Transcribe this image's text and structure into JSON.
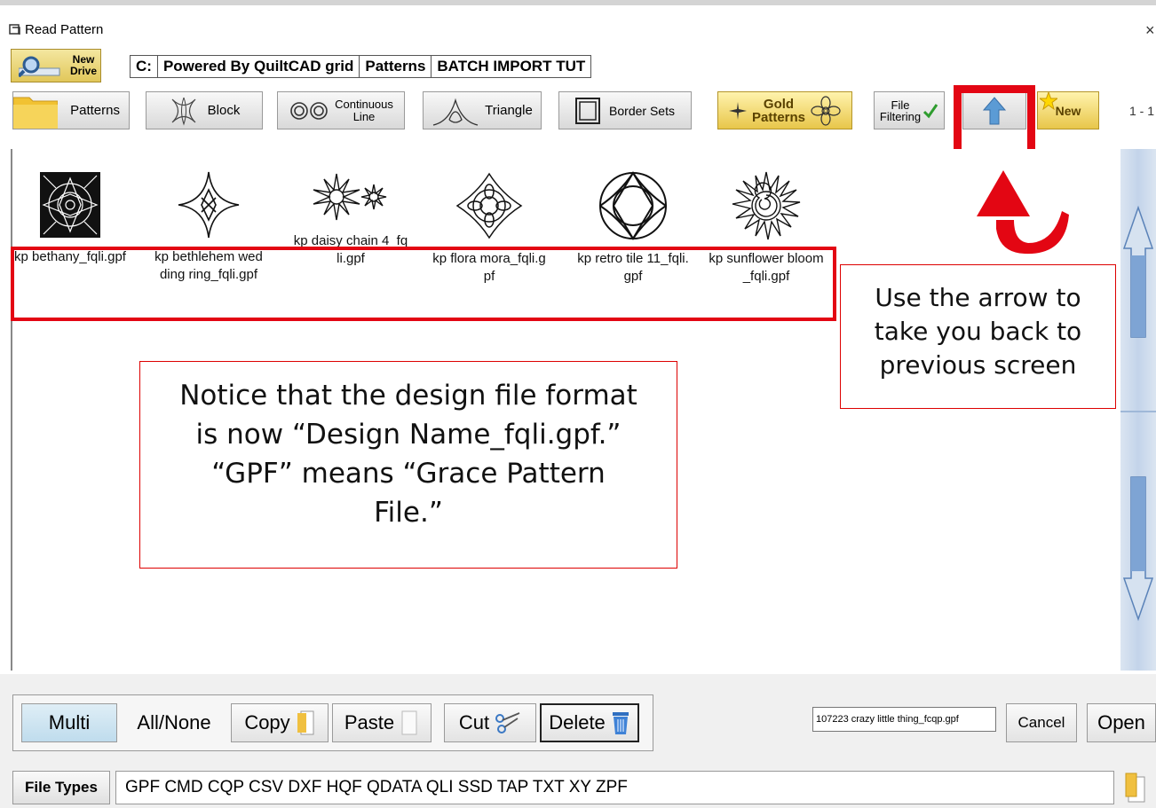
{
  "window": {
    "title": "Read Pattern",
    "close_glyph": "×"
  },
  "drive": {
    "new_drive_label_line1": "New",
    "new_drive_label_line2": "Drive"
  },
  "path": {
    "segments": [
      "C:",
      "Powered By QuiltCAD grid",
      "Patterns",
      "BATCH IMPORT TUT"
    ]
  },
  "toolbar": {
    "patterns": "Patterns",
    "block": "Block",
    "continuous_line1": "Continuous",
    "continuous_line2": "Line",
    "triangle": "Triangle",
    "border_sets": "Border Sets",
    "gold_line1": "Gold",
    "gold_line2": "Patterns",
    "file_filtering_line1": "File",
    "file_filtering_line2": "Filtering",
    "new": "New",
    "page_count": "1 - 1"
  },
  "patterns": [
    {
      "name": "kp bethany_fqli.gpf",
      "icon": "bethany-pattern-icon"
    },
    {
      "name": "kp bethlehem wedding ring_fqli.gpf",
      "icon": "bethlehem-pattern-icon"
    },
    {
      "name": "kp daisy chain 4_fqli.gpf",
      "icon": "daisy-chain-pattern-icon"
    },
    {
      "name": "kp flora mora_fqli.gpf",
      "icon": "flora-mora-pattern-icon"
    },
    {
      "name": "kp retro tile 11_fqli.gpf",
      "icon": "retro-tile-pattern-icon"
    },
    {
      "name": "kp sunflower bloom_fqli.gpf",
      "icon": "sunflower-pattern-icon"
    }
  ],
  "callouts": {
    "arrow_note": "Use the arrow to take you back to previous screen",
    "format_note": "Notice that the design file format is now “Design Name_fqli.gpf.” “GPF” means “Grace Pattern File.”"
  },
  "bottom": {
    "multi": "Multi",
    "all_none": "All/None",
    "copy": "Copy",
    "paste": "Paste",
    "cut": "Cut",
    "delete": "Delete",
    "filename_value": "107223 crazy little thing_fcqp.gpf",
    "cancel": "Cancel",
    "open": "Open",
    "file_types_label": "File Types",
    "file_types": "GPF CMD CQP CSV DXF HQF QDATA QLI SSD TAP TXT XY ZPF"
  },
  "colors": {
    "annotation_red": "#e30613",
    "scroll_blue": "#c3d4ea"
  }
}
